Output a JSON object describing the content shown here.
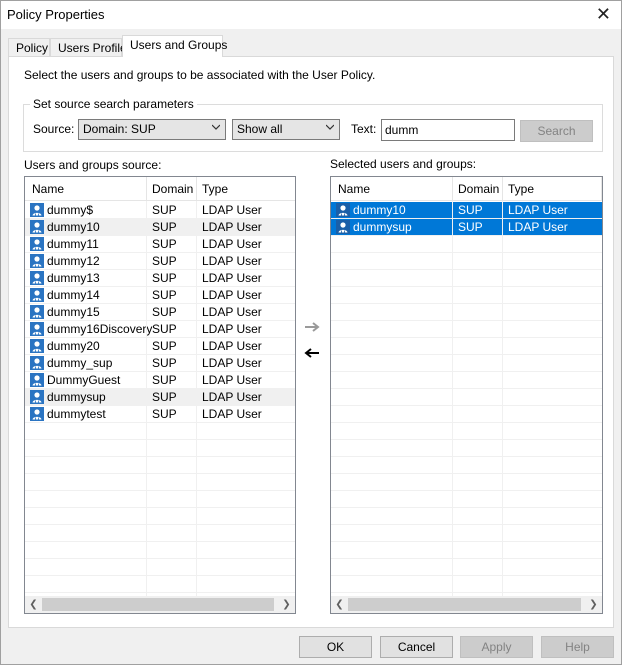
{
  "window": {
    "title": "Policy Properties",
    "close_label": "✕"
  },
  "tabs": [
    {
      "label": "Policy"
    },
    {
      "label": "Users Profile"
    },
    {
      "label": "Users and Groups"
    }
  ],
  "description": "Select the users and groups to be associated with the User Policy.",
  "search": {
    "group_title": "Set source search parameters",
    "source_label": "Source:",
    "source_value": "Domain: SUP",
    "filter_value": "Show all",
    "text_label": "Text:",
    "text_value": "dumm",
    "search_button": "Search"
  },
  "source_list": {
    "title": "Users and groups source:",
    "columns": [
      "Name",
      "Domain",
      "Type"
    ],
    "rows": [
      {
        "name": "dummy$",
        "domain": "SUP",
        "type": "LDAP User"
      },
      {
        "name": "dummy10",
        "domain": "SUP",
        "type": "LDAP User"
      },
      {
        "name": "dummy11",
        "domain": "SUP",
        "type": "LDAP User"
      },
      {
        "name": "dummy12",
        "domain": "SUP",
        "type": "LDAP User"
      },
      {
        "name": "dummy13",
        "domain": "SUP",
        "type": "LDAP User"
      },
      {
        "name": "dummy14",
        "domain": "SUP",
        "type": "LDAP User"
      },
      {
        "name": "dummy15",
        "domain": "SUP",
        "type": "LDAP User"
      },
      {
        "name": "dummy16Discovery",
        "domain": "SUP",
        "type": "LDAP User"
      },
      {
        "name": "dummy20",
        "domain": "SUP",
        "type": "LDAP User"
      },
      {
        "name": "dummy_sup",
        "domain": "SUP",
        "type": "LDAP User"
      },
      {
        "name": "DummyGuest",
        "domain": "SUP",
        "type": "LDAP User"
      },
      {
        "name": "dummysup",
        "domain": "SUP",
        "type": "LDAP User"
      },
      {
        "name": "dummytest",
        "domain": "SUP",
        "type": "LDAP User"
      }
    ]
  },
  "selected_list": {
    "title": "Selected users and groups:",
    "columns": [
      "Name",
      "Domain",
      "Type"
    ],
    "rows": [
      {
        "name": "dummy10",
        "domain": "SUP",
        "type": "LDAP User"
      },
      {
        "name": "dummysup",
        "domain": "SUP",
        "type": "LDAP User"
      }
    ]
  },
  "buttons": {
    "ok": "OK",
    "cancel": "Cancel",
    "apply": "Apply",
    "help": "Help"
  },
  "colors": {
    "selection": "#0078d7",
    "icon": "#1e6fb8"
  }
}
